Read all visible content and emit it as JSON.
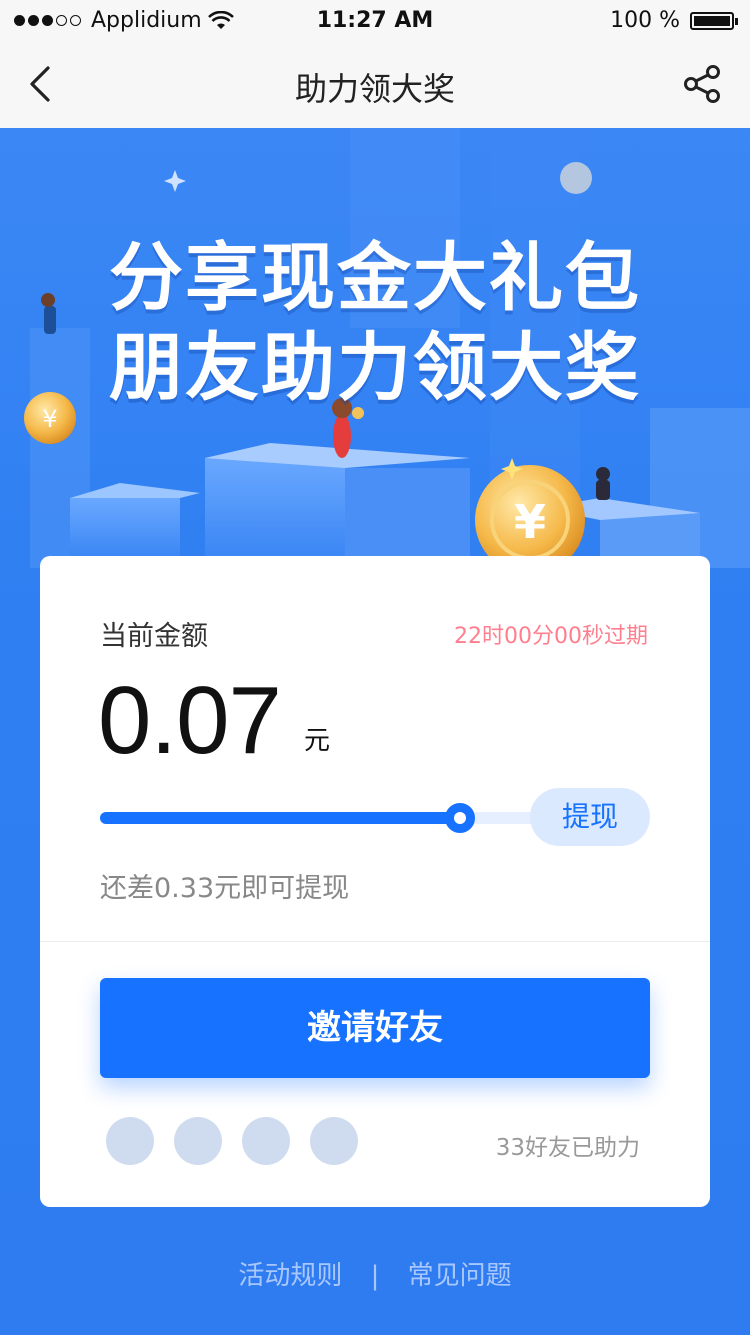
{
  "status_bar": {
    "carrier": "Applidium",
    "time": "11:27 AM",
    "battery": "100 %"
  },
  "nav": {
    "title": "助力领大奖",
    "back_icon": "chevron-left-icon",
    "share_icon": "share-icon"
  },
  "hero": {
    "line1": "分享现金大礼包",
    "line2": "朋友助力领大奖"
  },
  "card": {
    "current_label": "当前金额",
    "expire_text": "22时00分00秒过期",
    "amount": "0.07",
    "unit": "元",
    "progress": 0.8,
    "withdraw_label": "提现",
    "remain_text": "还差0.33元即可提现",
    "invite_label": "邀请好友",
    "helped_text": "33好友已助力"
  },
  "footer": {
    "rules": "活动规则",
    "sep": "|",
    "faq": "常见问题"
  },
  "colors": {
    "primary": "#1672ff",
    "background": "#2f7ff2",
    "expire": "#ff7f8f"
  }
}
